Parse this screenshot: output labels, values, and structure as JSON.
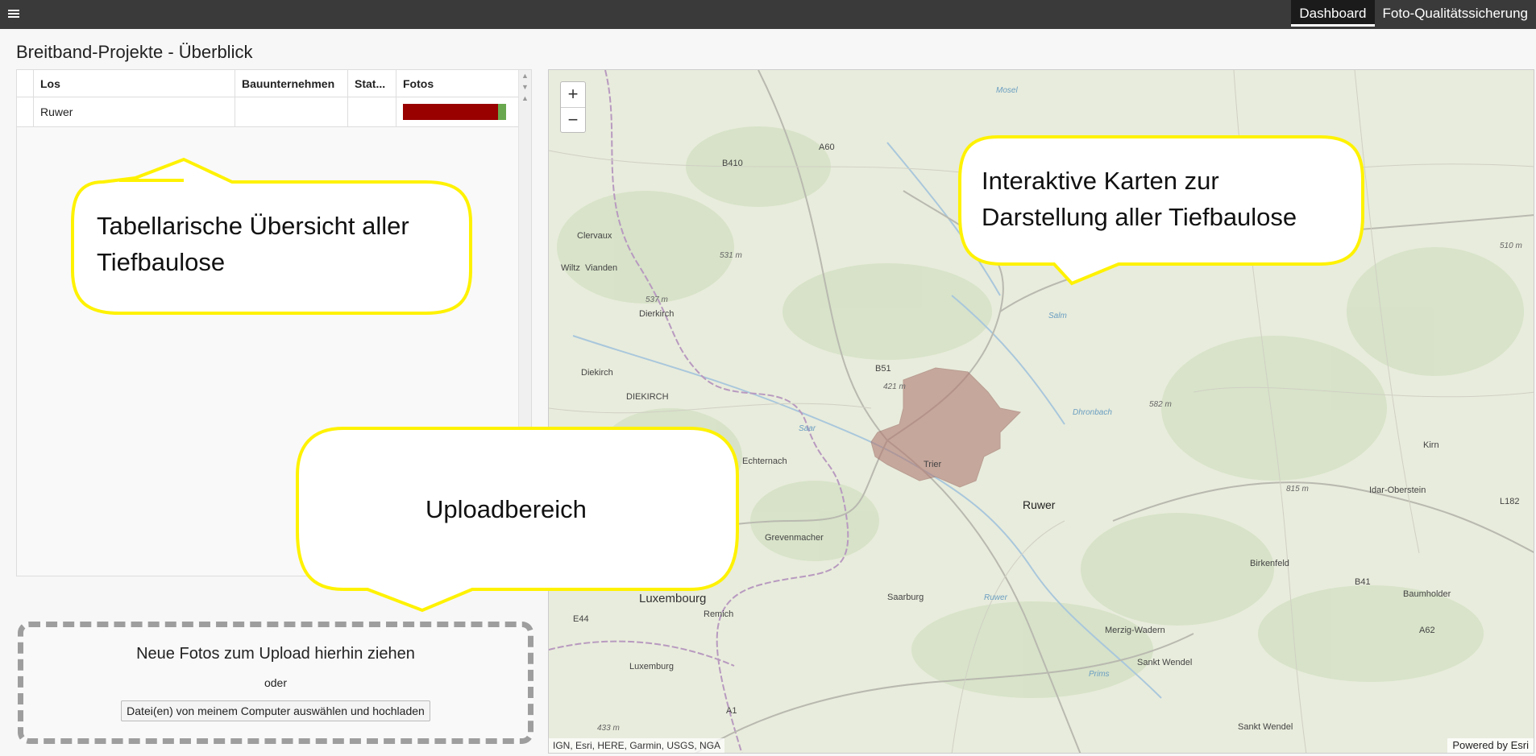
{
  "topbar": {
    "menu_icon": "list-icon",
    "nav": [
      {
        "label": "Dashboard",
        "active": true
      },
      {
        "label": "Foto-Qualitätssicherung",
        "active": false
      }
    ]
  },
  "page": {
    "title": "Breitband-Projekte - Überblick"
  },
  "table": {
    "columns": [
      "Los",
      "Bauunternehmen",
      "Stat...",
      "Fotos"
    ],
    "rows": [
      {
        "los": "Ruwer",
        "bauunternehmen": "",
        "status": "",
        "fotos_red_fraction": 0.92,
        "fotos_green_fraction": 0.08
      }
    ]
  },
  "upload": {
    "title": "Neue Fotos zum Upload hierhin ziehen",
    "or": "oder",
    "button": "Datei(en) von meinem Computer auswählen und hochladen"
  },
  "map": {
    "zoom_in": "+",
    "zoom_out": "−",
    "attribution": "IGN, Esri, HERE, Garmin, USGS, NGA",
    "powered": "Powered by Esri",
    "region_label": "Ruwer",
    "region_color": "#b07a72",
    "places": [
      "Dierkirch",
      "Diekirch",
      "DIEKIRCH",
      "Trier",
      "Grevenmacher",
      "Luxembourg",
      "Saarburg",
      "Birkenfeld",
      "Baumholder",
      "Idar-Oberstein",
      "Kirn",
      "Sankt Wendel",
      "Remich",
      "Echternach",
      "Vianden",
      "Clervaux",
      "Wiltz",
      "Luxemburg",
      "Ruwer",
      "Dhronbach",
      "Prims",
      "Merzig-Wadern",
      "Sankt Wendel",
      "Mosel",
      "Saar",
      "Salm"
    ],
    "elevations": [
      "531 m",
      "537 m",
      "421 m",
      "582 m",
      "815 m",
      "510 m",
      "433 m"
    ],
    "roads": [
      "A60",
      "A1",
      "A62",
      "B51",
      "E44",
      "B41",
      "L182",
      "B410"
    ]
  },
  "callouts": {
    "table": [
      "Tabellarische Übersicht aller",
      "Tiefbaulose"
    ],
    "map": [
      "Interaktive Karten zur",
      "Darstellung aller Tiefbaulose"
    ],
    "upload": "Uploadbereich"
  },
  "colors": {
    "topbar": "#3a3a3a",
    "callout_border": "#fff200",
    "fotos_red": "#990000",
    "fotos_green": "#6aa84f"
  }
}
